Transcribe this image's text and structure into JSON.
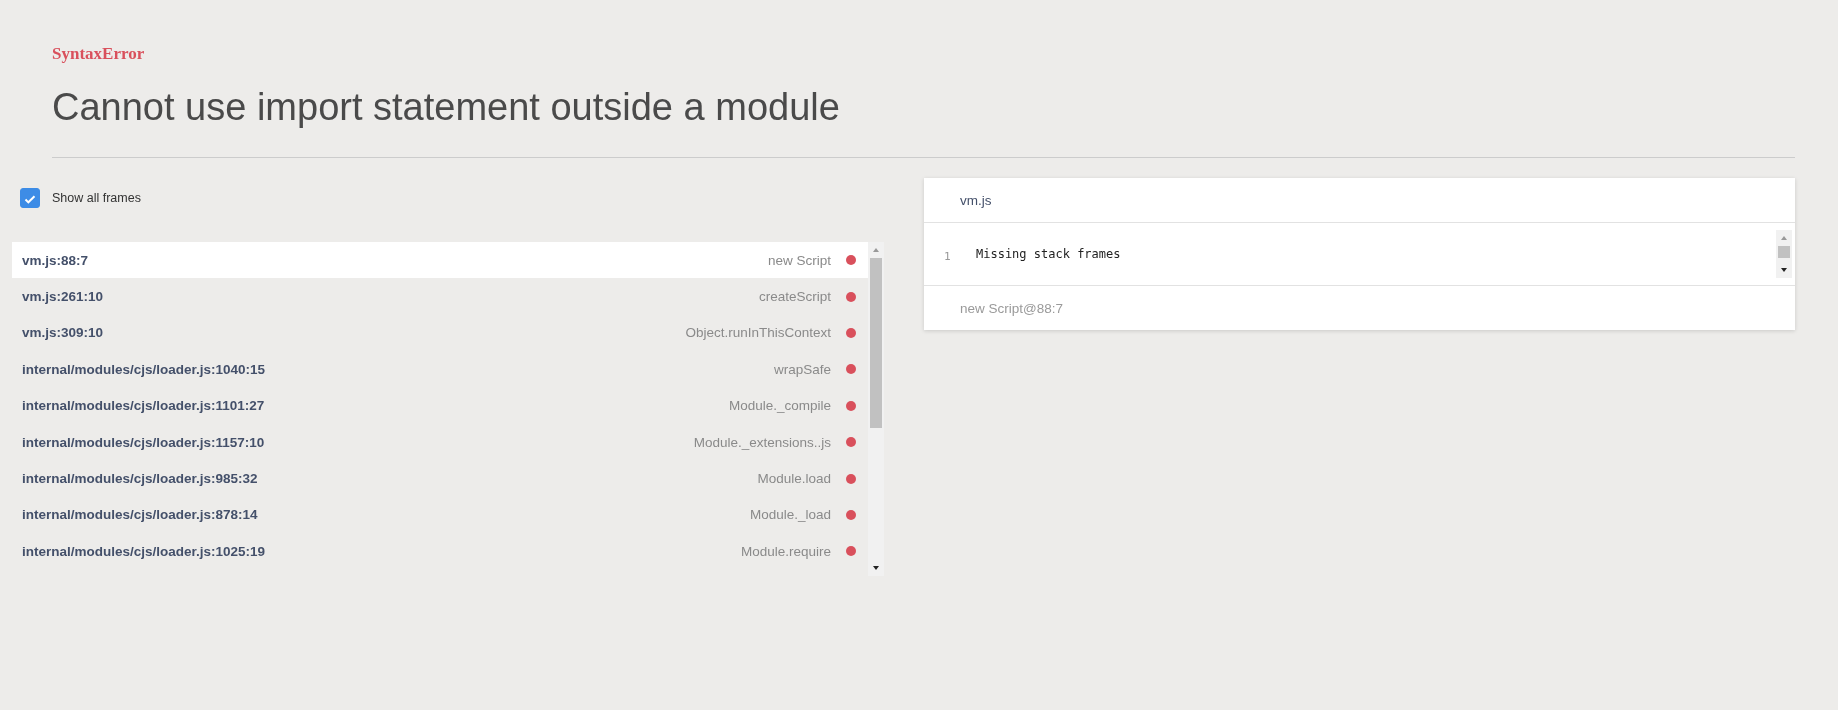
{
  "error": {
    "type": "SyntaxError",
    "message": "Cannot use import statement outside a module"
  },
  "show_all_frames": {
    "label": "Show all frames",
    "checked": true
  },
  "frames": [
    {
      "location": "vm.js:88:7",
      "function": "new Script",
      "selected": true
    },
    {
      "location": "vm.js:261:10",
      "function": "createScript",
      "selected": false
    },
    {
      "location": "vm.js:309:10",
      "function": "Object.runInThisContext",
      "selected": false
    },
    {
      "location": "internal/modules/cjs/loader.js:1040:15",
      "function": "wrapSafe",
      "selected": false
    },
    {
      "location": "internal/modules/cjs/loader.js:1101:27",
      "function": "Module._compile",
      "selected": false
    },
    {
      "location": "internal/modules/cjs/loader.js:1157:10",
      "function": "Module._extensions..js",
      "selected": false
    },
    {
      "location": "internal/modules/cjs/loader.js:985:32",
      "function": "Module.load",
      "selected": false
    },
    {
      "location": "internal/modules/cjs/loader.js:878:14",
      "function": "Module._load",
      "selected": false
    },
    {
      "location": "internal/modules/cjs/loader.js:1025:19",
      "function": "Module.require",
      "selected": false
    }
  ],
  "source_panel": {
    "file": "vm.js",
    "lines": [
      {
        "number": "1",
        "code": "Missing stack frames"
      }
    ],
    "footer": "new Script@88:7"
  }
}
